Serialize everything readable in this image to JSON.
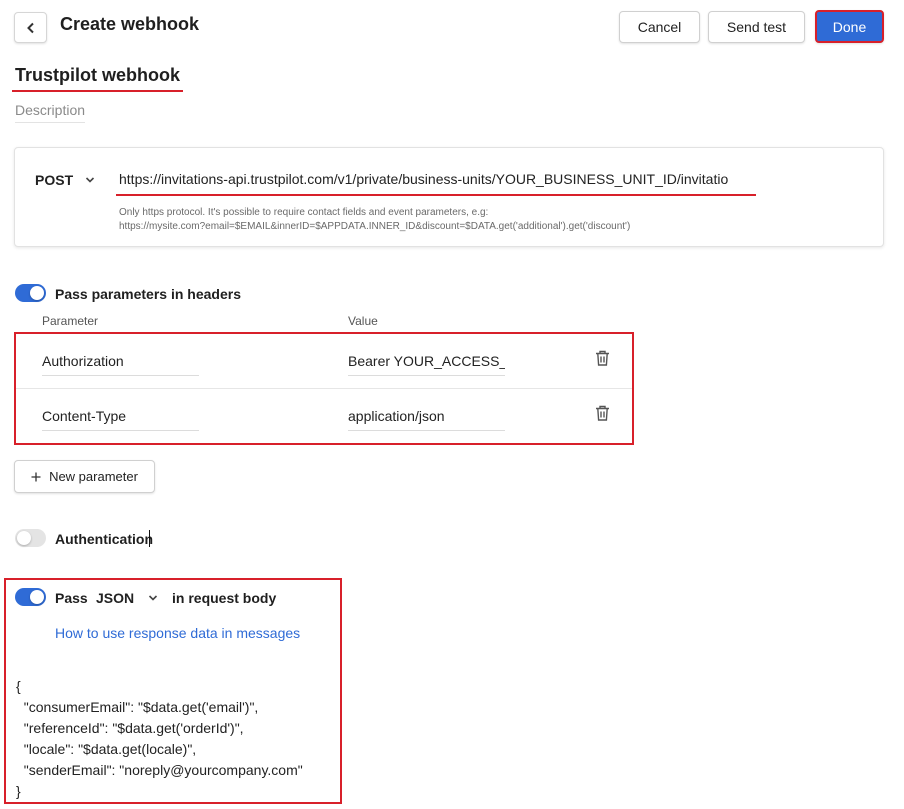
{
  "header": {
    "title": "Create webhook",
    "cancel_label": "Cancel",
    "send_test_label": "Send test",
    "done_label": "Done"
  },
  "webhook": {
    "name": "Trustpilot webhook",
    "description_placeholder": "Description"
  },
  "request": {
    "method": "POST",
    "url": "https://invitations-api.trustpilot.com/v1/private/business-units/YOUR_BUSINESS_UNIT_ID/invitatio",
    "hint_line1": "Only https protocol. It's possible to require contact fields and event parameters, e.g:",
    "hint_line2": "https://mysite.com?email=$EMAIL&innerID=$APPDATA.INNER_ID&discount=$DATA.get('additional').get('discount')"
  },
  "headers": {
    "toggle_on": true,
    "label": "Pass parameters in headers",
    "col_parameter": "Parameter",
    "col_value": "Value",
    "rows": [
      {
        "key": "Authorization",
        "value": "Bearer YOUR_ACCESS_T"
      },
      {
        "key": "Content-Type",
        "value": "application/json"
      }
    ],
    "new_parameter_label": "New parameter"
  },
  "authentication": {
    "toggle_on": false,
    "label": "Authentication"
  },
  "body": {
    "toggle_on": true,
    "pass_label": "Pass",
    "format": "JSON",
    "suffix_label": "in request body",
    "help_link": "How to use response data in messages",
    "content": "{\n  \"consumerEmail\": \"$data.get('email')\",\n  \"referenceId\": \"$data.get('orderId')\",\n  \"locale\": \"$data.get(locale)\",\n  \"senderEmail\": \"noreply@yourcompany.com\"\n}"
  },
  "colors": {
    "accent": "#2f6bd6",
    "highlight": "#d8202a"
  }
}
